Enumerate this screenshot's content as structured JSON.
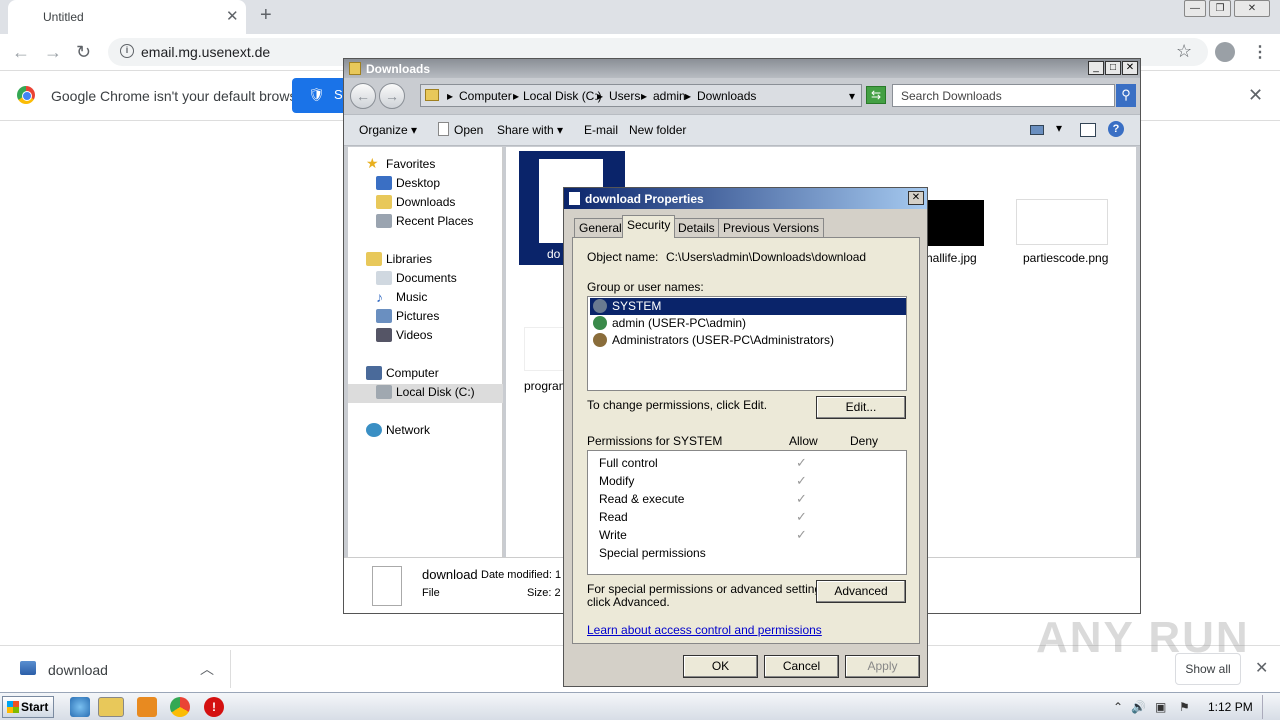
{
  "chrome": {
    "tab_title": "Untitled",
    "tab_close": "✕",
    "new_tab": "+",
    "url": "email.mg.usenext.de",
    "infobar_text": "Google Chrome isn't your default browser",
    "set_default_label": "S",
    "download_name": "download",
    "show_all": "Show all",
    "watermark": "ANY RUN"
  },
  "explorer": {
    "title": "Downloads",
    "breadcrumb": [
      "Computer",
      "Local Disk (C:)",
      "Users",
      "admin",
      "Downloads"
    ],
    "search_placeholder": "Search Downloads",
    "toolbar": {
      "organize": "Organize",
      "open": "Open",
      "share_with": "Share with",
      "email": "E-mail",
      "new_folder": "New folder"
    },
    "nav": {
      "favorites": "Favorites",
      "desktop": "Desktop",
      "downloads": "Downloads",
      "recent": "Recent Places",
      "libraries": "Libraries",
      "documents": "Documents",
      "music": "Music",
      "pictures": "Pictures",
      "videos": "Videos",
      "computer": "Computer",
      "local_disk": "Local Disk (C:)",
      "network": "Network"
    },
    "files": {
      "download": "do",
      "hallife": "hallife.jpg",
      "parties": "partiescode.png",
      "program": "program"
    },
    "details": {
      "name": "download",
      "date_label": "Date modified: 1",
      "type": "File",
      "size_label": "Size: 2"
    }
  },
  "props": {
    "title": "download Properties",
    "tabs": {
      "general": "General",
      "security": "Security",
      "details": "Details",
      "previous": "Previous Versions"
    },
    "object_label": "Object name:",
    "object_value": "C:\\Users\\admin\\Downloads\\download",
    "group_label": "Group or user names:",
    "users": [
      "SYSTEM",
      "admin (USER-PC\\admin)",
      "Administrators (USER-PC\\Administrators)"
    ],
    "change_text": "To change permissions, click Edit.",
    "edit_btn": "Edit...",
    "perm_for": "Permissions for SYSTEM",
    "allow": "Allow",
    "deny": "Deny",
    "permissions": [
      "Full control",
      "Modify",
      "Read & execute",
      "Read",
      "Write",
      "Special permissions"
    ],
    "check": "✓",
    "special_text_1": "For special permissions or advanced settings,",
    "special_text_2": "click Advanced.",
    "advanced_btn": "Advanced",
    "learn_link": "Learn about access control and permissions",
    "ok": "OK",
    "cancel": "Cancel",
    "apply": "Apply"
  },
  "taskbar": {
    "start": "Start",
    "time": "1:12 PM"
  }
}
